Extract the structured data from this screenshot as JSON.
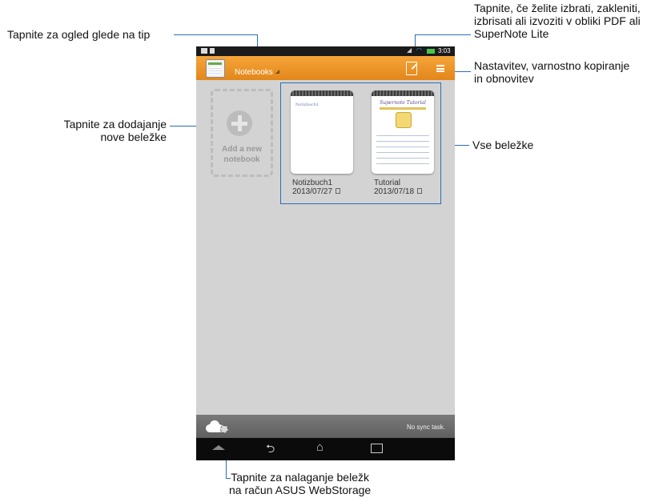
{
  "annotations": {
    "view_by_type": "Tapnite za ogled glede na tip",
    "select_lock": [
      "Tapnite, če želite izbrati, zakleniti,",
      "izbrisati ali izvoziti v obliki PDF ali",
      "SuperNote Lite"
    ],
    "settings": [
      "Nastavitev, varnostno kopiranje",
      "in obnovitev"
    ],
    "add_notebook": [
      "Tapnite za dodajanje",
      "nove beležke"
    ],
    "all_notes": "Vse beležke",
    "upload": [
      "Tapnite za nalaganje beležk",
      "na račun ASUS WebStorage"
    ]
  },
  "status_bar": {
    "time": "3:03"
  },
  "action_bar": {
    "title": "Notebooks"
  },
  "add_tile": {
    "line1": "Add a new",
    "line2": "notebook"
  },
  "notebooks": [
    {
      "name": "Notizbuch1",
      "date": "2013/07/27",
      "preview_text": "Notizbuch1"
    },
    {
      "name": "Tutorial",
      "date": "2013/07/18",
      "preview_title": "Supernote Tutorial"
    }
  ],
  "bottom_bar": {
    "sync_status": "No sync task."
  },
  "colors": {
    "accent_orange": "#F39A2A",
    "callout_blue": "#2A6FB6"
  }
}
